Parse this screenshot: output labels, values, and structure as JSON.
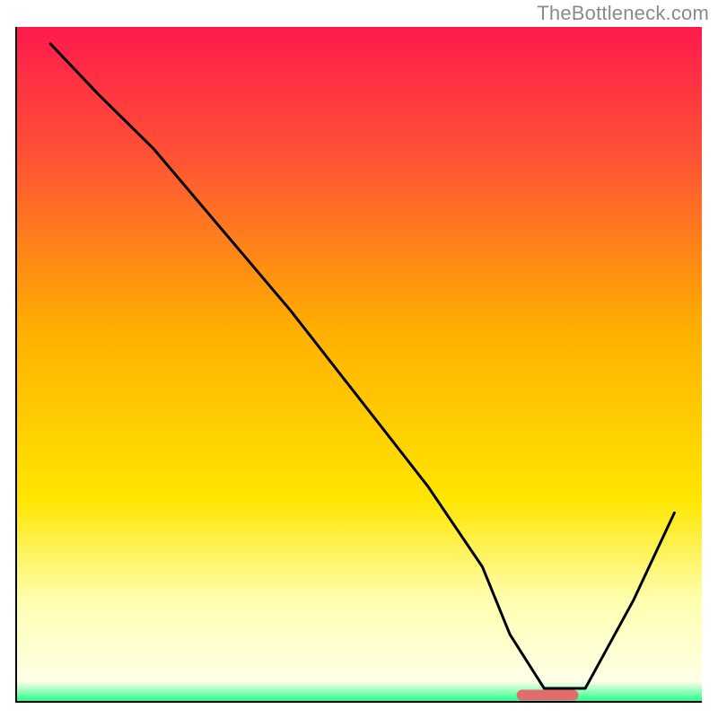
{
  "watermark": "TheBottleneck.com",
  "chart_data": {
    "type": "line",
    "title": "",
    "xlabel": "",
    "ylabel": "",
    "xlim": [
      0,
      1
    ],
    "ylim": [
      0,
      1
    ],
    "note": "Axes are unlabeled in the source image; x and y are normalized to [0,1].",
    "background_gradient": {
      "direction": "vertical",
      "stops": [
        {
          "pos": 0.0,
          "color": "#ff1a4d"
        },
        {
          "pos": 0.2,
          "color": "#ff5533"
        },
        {
          "pos": 0.45,
          "color": "#ffb000"
        },
        {
          "pos": 0.7,
          "color": "#ffe600"
        },
        {
          "pos": 0.85,
          "color": "#ffffb0"
        },
        {
          "pos": 0.97,
          "color": "#ffffe8"
        },
        {
          "pos": 1.0,
          "color": "#1cff87"
        }
      ]
    },
    "series": [
      {
        "name": "bottleneck-curve",
        "color": "#000000",
        "x": [
          0.05,
          0.12,
          0.2,
          0.3,
          0.4,
          0.5,
          0.6,
          0.68,
          0.72,
          0.77,
          0.83,
          0.9,
          0.96
        ],
        "y": [
          0.975,
          0.9,
          0.82,
          0.7,
          0.58,
          0.45,
          0.32,
          0.2,
          0.1,
          0.02,
          0.02,
          0.15,
          0.28
        ]
      }
    ],
    "marker": {
      "name": "optimal-range",
      "color": "#e26d6d",
      "x_start": 0.73,
      "x_end": 0.82,
      "y": 0.01
    },
    "plot_frame": {
      "visible_sides": [
        "left",
        "bottom"
      ],
      "color": "#000000",
      "width": 2
    }
  }
}
